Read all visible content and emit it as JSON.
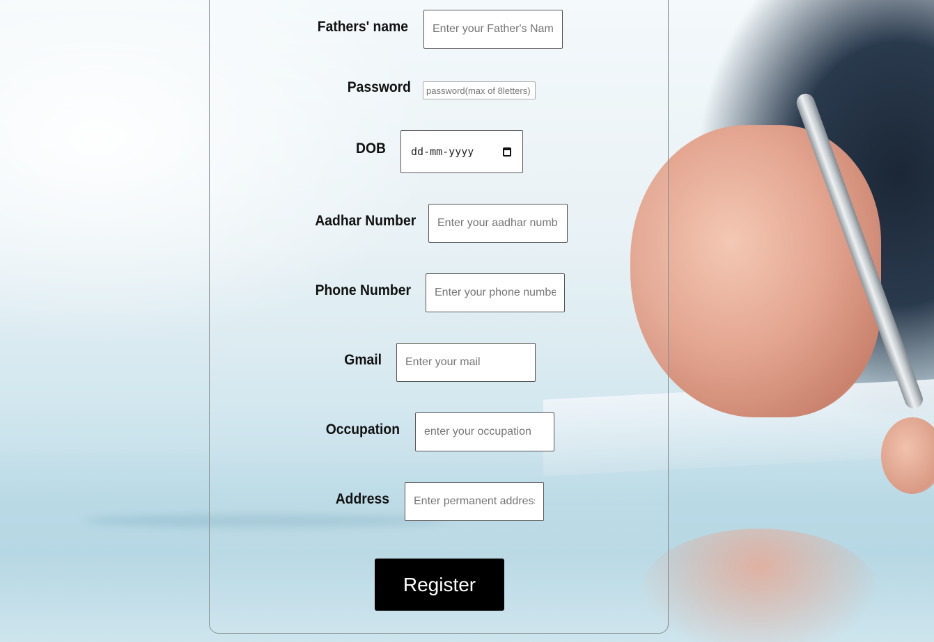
{
  "form": {
    "fields": [
      {
        "label": "Fathers' name",
        "placeholder": "Enter your Father's Name"
      },
      {
        "label": "Password",
        "placeholder": "password(max of 8letters)"
      },
      {
        "label": "DOB",
        "value": "dd-mm-yyyy"
      },
      {
        "label": "Aadhar Number",
        "placeholder": "Enter your aadhar numb"
      },
      {
        "label": "Phone Number",
        "placeholder": "Enter your phone numbe"
      },
      {
        "label": "Gmail",
        "placeholder": "Enter your mail"
      },
      {
        "label": "Occupation",
        "placeholder": "enter your occupation"
      },
      {
        "label": "Address",
        "placeholder": "Enter permanent address"
      }
    ],
    "submit_label": "Register"
  },
  "icons": {
    "dob_picker": "calendar-icon"
  }
}
